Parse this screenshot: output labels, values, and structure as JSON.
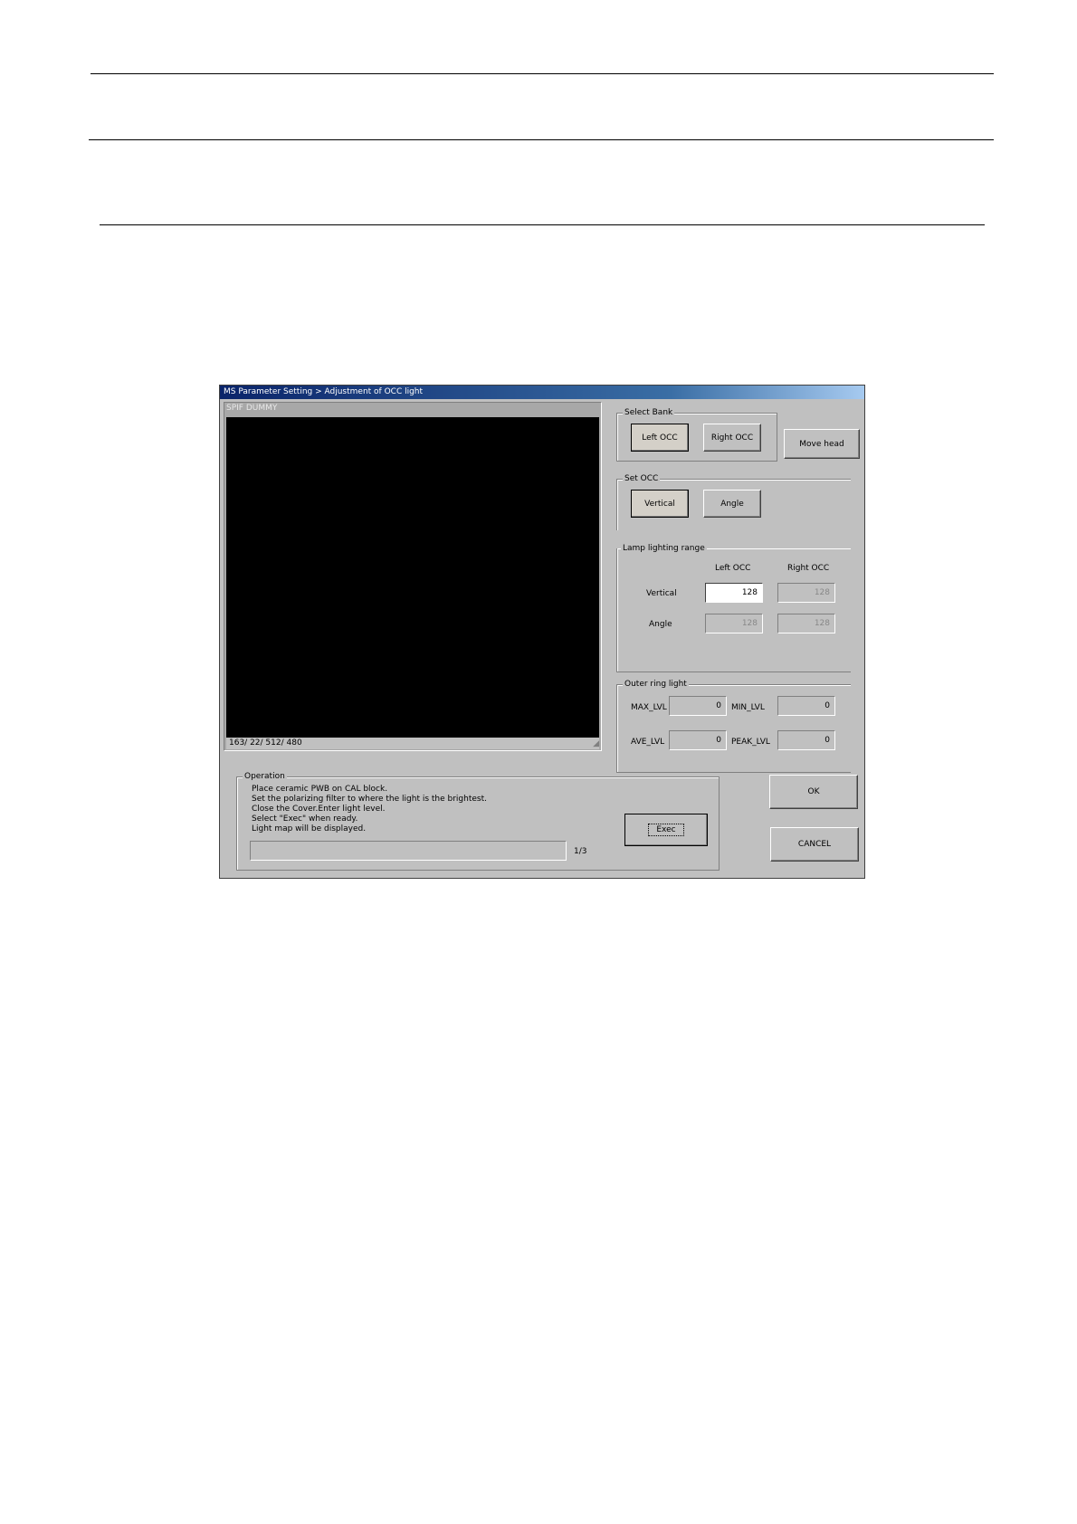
{
  "window": {
    "title": "MS Parameter Setting > Adjustment of OCC light"
  },
  "viewer": {
    "caption": "SPIF DUMMY",
    "status": "163/  22/ 512/ 480"
  },
  "select_bank": {
    "label": "Select Bank",
    "left_occ": "Left OCC",
    "right_occ": "Right OCC",
    "selected": "Left OCC"
  },
  "move_head": "Move head",
  "set_occ": {
    "label": "Set OCC",
    "vertical": "Vertical",
    "angle": "Angle",
    "selected": "Vertical"
  },
  "lamp_range": {
    "label": "Lamp lighting range",
    "col_left": "Left OCC",
    "col_right": "Right OCC",
    "row_vertical": "Vertical",
    "row_angle": "Angle",
    "vertical_left": "128",
    "vertical_right": "128",
    "angle_left": "128",
    "angle_right": "128"
  },
  "outer_ring": {
    "label": "Outer ring light",
    "max_label": "MAX_LVL",
    "max_value": "0",
    "min_label": "MIN_LVL",
    "min_value": "0",
    "ave_label": "AVE_LVL",
    "ave_value": "0",
    "peak_label": "PEAK_LVL",
    "peak_value": "0"
  },
  "operation": {
    "label": "Operation",
    "lines": [
      "Place ceramic PWB on CAL block.",
      "Set the polarizing filter to where the light is the brightest.",
      "Close the Cover.Enter light level.",
      "Select \"Exec\" when ready.",
      "Light map will be displayed."
    ],
    "step": "1/3",
    "progress": 0,
    "exec": "Exec"
  },
  "ok": "OK",
  "cancel": "CANCEL"
}
